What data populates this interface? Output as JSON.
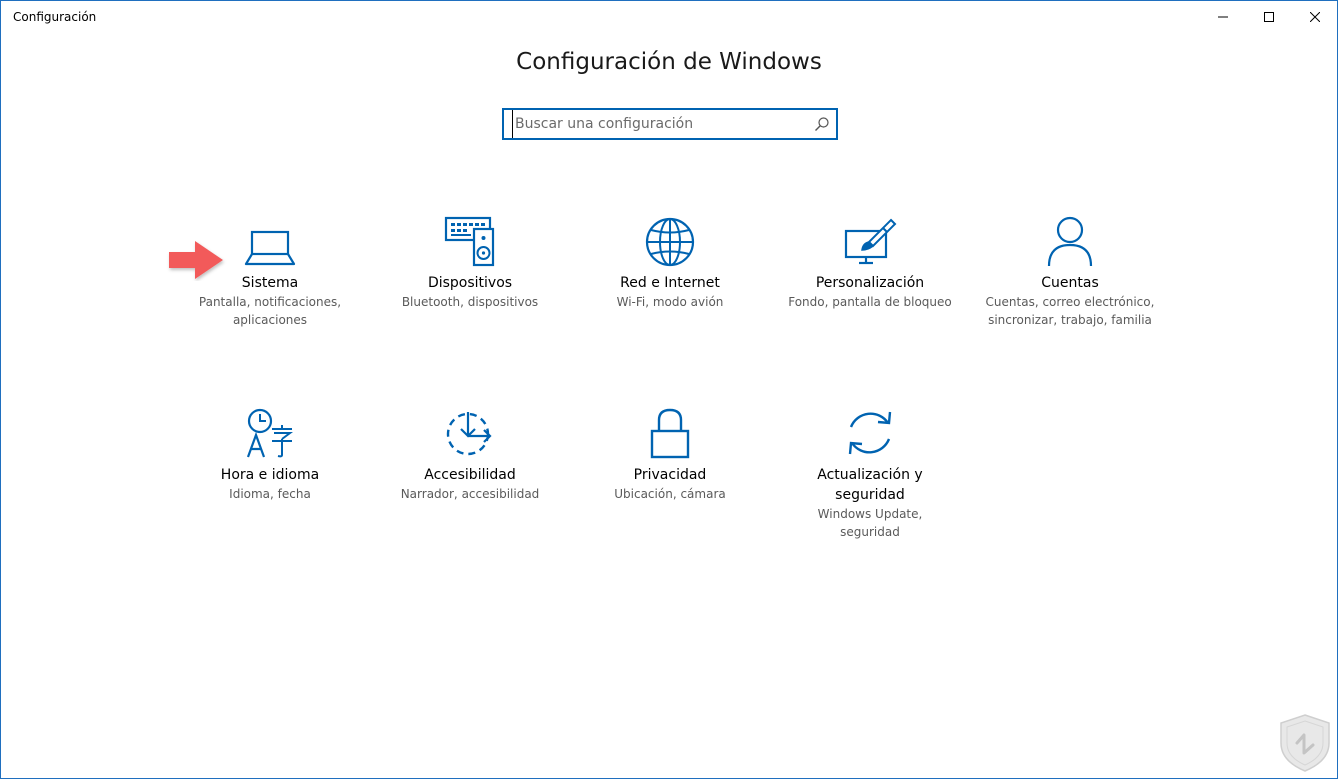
{
  "window": {
    "title": "Configuración"
  },
  "header": {
    "title": "Configuración de Windows"
  },
  "search": {
    "placeholder": "Buscar una configuración",
    "value": ""
  },
  "tiles": [
    {
      "icon": "laptop-icon",
      "title": "Sistema",
      "desc1": "Pantalla, notificaciones,",
      "desc2": "aplicaciones"
    },
    {
      "icon": "devices-icon",
      "title": "Dispositivos",
      "desc1": "Bluetooth, dispositivos",
      "desc2": ""
    },
    {
      "icon": "globe-icon",
      "title": "Red e Internet",
      "desc1": "Wi-Fi, modo avión",
      "desc2": ""
    },
    {
      "icon": "personalization-icon",
      "title": "Personalización",
      "desc1": "Fondo, pantalla de bloqueo",
      "desc2": ""
    },
    {
      "icon": "person-icon",
      "title": "Cuentas",
      "desc1": "Cuentas, correo electrónico,",
      "desc2": "sincronizar, trabajo, familia"
    },
    {
      "icon": "time-language-icon",
      "title": "Hora e idioma",
      "desc1": "Idioma, fecha",
      "desc2": ""
    },
    {
      "icon": "accessibility-icon",
      "title": "Accesibilidad",
      "desc1": "Narrador, accesibilidad",
      "desc2": ""
    },
    {
      "icon": "lock-icon",
      "title": "Privacidad",
      "desc1": "Ubicación, cámara",
      "desc2": ""
    },
    {
      "icon": "update-icon",
      "title": "Actualización y",
      "title2": "seguridad",
      "desc1": "Windows Update,",
      "desc2": "seguridad"
    }
  ],
  "colors": {
    "accent": "#0063b1",
    "arrow": "#f25a5a",
    "text": "#000000",
    "subtext": "#5a5a5a"
  }
}
